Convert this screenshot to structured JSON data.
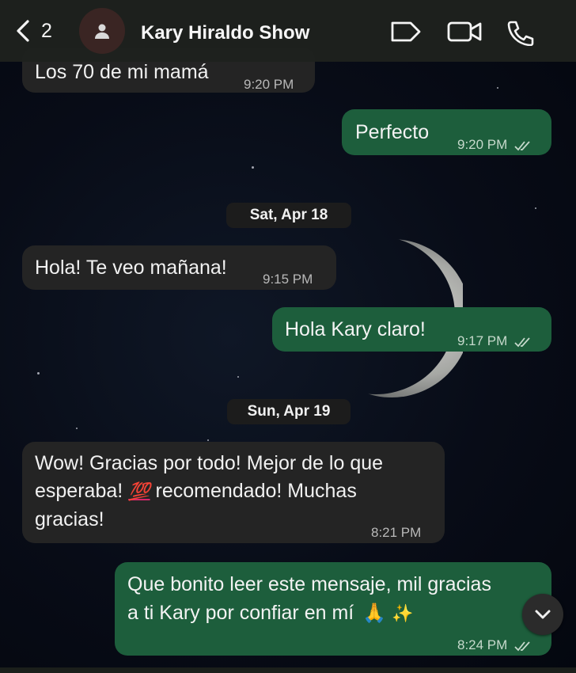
{
  "header": {
    "back_count": "2",
    "contact_name": "Kary Hiraldo Show",
    "icons": [
      "chevron-left-icon",
      "contact-avatar-icon",
      "label-tag-icon",
      "video-call-icon",
      "phone-call-icon"
    ]
  },
  "messages": [
    {
      "direction": "in",
      "text": "Los 70 de mi mamá",
      "time": "9:20 PM"
    },
    {
      "direction": "out",
      "text": "Perfecto",
      "time": "9:20 PM",
      "status": "read"
    },
    {
      "direction": "in",
      "text": "Hola! Te veo mañana!",
      "time": "9:15 PM"
    },
    {
      "direction": "out",
      "text": "Hola Kary claro!",
      "time": "9:17 PM",
      "status": "read"
    },
    {
      "direction": "in",
      "line1": "Wow! Gracias por todo! Mejor de lo que",
      "line2_pre": "esperaba!",
      "line2_emoji": "💯",
      "line2_post": "recomendado! Muchas",
      "line3": "gracias!",
      "time": "8:21 PM"
    },
    {
      "direction": "out",
      "line1": "Que bonito leer este mensaje, mil gracias",
      "line2": "a ti Kary por confiar en mí",
      "emojis": [
        "🙏",
        "✨"
      ],
      "time": "8:24 PM",
      "status": "read"
    }
  ],
  "date_separators": [
    "Sat, Apr 18",
    "Sun, Apr 19"
  ],
  "colors": {
    "incoming_bubble": "#242424",
    "outgoing_bubble": "#1d5e3c",
    "header_bg": "#1e211e",
    "background": "#060a14"
  }
}
